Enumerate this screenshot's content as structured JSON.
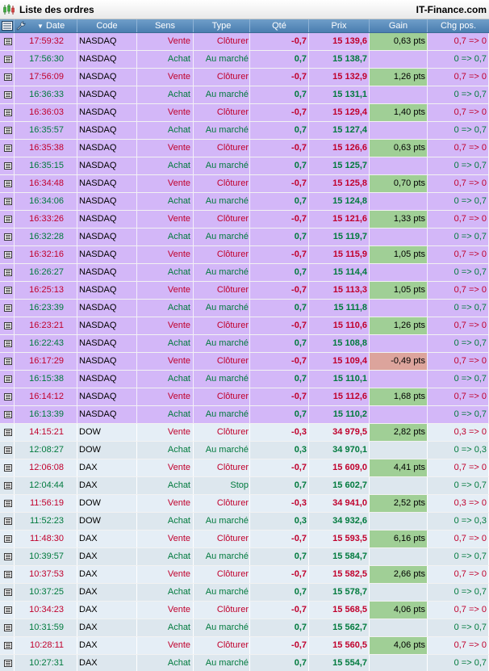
{
  "window": {
    "title": "Liste des ordres",
    "brand": "IT-Finance.com",
    "logo_icon": "candlestick-chart-icon"
  },
  "columns": {
    "icon": "columns-menu-icon",
    "tools": "wrench-icon",
    "sort_indicator": "sort-descending-icon",
    "date": "Date",
    "code": "Code",
    "sens": "Sens",
    "type": "Type",
    "qte": "Qté",
    "prix": "Prix",
    "gain": "Gain",
    "chg": "Chg pos."
  },
  "colors": {
    "nasdaq_row": "#d3b7f8",
    "other_row_even": "#e5eef6",
    "other_row_odd": "#dde7ee",
    "sell": "#c0002c",
    "buy": "#007a3d",
    "gain_positive": "#a0cf96",
    "gain_negative": "#dca49c",
    "header": "#5b8cbd"
  },
  "orders": [
    {
      "date": "17:59:32",
      "code": "NASDAQ",
      "sens": "Vente",
      "type": "Clôturer",
      "qte": "-0,7",
      "prix": "15 139,6",
      "gain": "0,63 pts",
      "chg": "0,7 => 0"
    },
    {
      "date": "17:56:30",
      "code": "NASDAQ",
      "sens": "Achat",
      "type": "Au marché",
      "qte": "0,7",
      "prix": "15 138,7",
      "gain": "",
      "chg": "0 => 0,7"
    },
    {
      "date": "17:56:09",
      "code": "NASDAQ",
      "sens": "Vente",
      "type": "Clôturer",
      "qte": "-0,7",
      "prix": "15 132,9",
      "gain": "1,26 pts",
      "chg": "0,7 => 0"
    },
    {
      "date": "16:36:33",
      "code": "NASDAQ",
      "sens": "Achat",
      "type": "Au marché",
      "qte": "0,7",
      "prix": "15 131,1",
      "gain": "",
      "chg": "0 => 0,7"
    },
    {
      "date": "16:36:03",
      "code": "NASDAQ",
      "sens": "Vente",
      "type": "Clôturer",
      "qte": "-0,7",
      "prix": "15 129,4",
      "gain": "1,40 pts",
      "chg": "0,7 => 0"
    },
    {
      "date": "16:35:57",
      "code": "NASDAQ",
      "sens": "Achat",
      "type": "Au marché",
      "qte": "0,7",
      "prix": "15 127,4",
      "gain": "",
      "chg": "0 => 0,7"
    },
    {
      "date": "16:35:38",
      "code": "NASDAQ",
      "sens": "Vente",
      "type": "Clôturer",
      "qte": "-0,7",
      "prix": "15 126,6",
      "gain": "0,63 pts",
      "chg": "0,7 => 0"
    },
    {
      "date": "16:35:15",
      "code": "NASDAQ",
      "sens": "Achat",
      "type": "Au marché",
      "qte": "0,7",
      "prix": "15 125,7",
      "gain": "",
      "chg": "0 => 0,7"
    },
    {
      "date": "16:34:48",
      "code": "NASDAQ",
      "sens": "Vente",
      "type": "Clôturer",
      "qte": "-0,7",
      "prix": "15 125,8",
      "gain": "0,70 pts",
      "chg": "0,7 => 0"
    },
    {
      "date": "16:34:06",
      "code": "NASDAQ",
      "sens": "Achat",
      "type": "Au marché",
      "qte": "0,7",
      "prix": "15 124,8",
      "gain": "",
      "chg": "0 => 0,7"
    },
    {
      "date": "16:33:26",
      "code": "NASDAQ",
      "sens": "Vente",
      "type": "Clôturer",
      "qte": "-0,7",
      "prix": "15 121,6",
      "gain": "1,33 pts",
      "chg": "0,7 => 0"
    },
    {
      "date": "16:32:28",
      "code": "NASDAQ",
      "sens": "Achat",
      "type": "Au marché",
      "qte": "0,7",
      "prix": "15 119,7",
      "gain": "",
      "chg": "0 => 0,7"
    },
    {
      "date": "16:32:16",
      "code": "NASDAQ",
      "sens": "Vente",
      "type": "Clôturer",
      "qte": "-0,7",
      "prix": "15 115,9",
      "gain": "1,05 pts",
      "chg": "0,7 => 0"
    },
    {
      "date": "16:26:27",
      "code": "NASDAQ",
      "sens": "Achat",
      "type": "Au marché",
      "qte": "0,7",
      "prix": "15 114,4",
      "gain": "",
      "chg": "0 => 0,7"
    },
    {
      "date": "16:25:13",
      "code": "NASDAQ",
      "sens": "Vente",
      "type": "Clôturer",
      "qte": "-0,7",
      "prix": "15 113,3",
      "gain": "1,05 pts",
      "chg": "0,7 => 0"
    },
    {
      "date": "16:23:39",
      "code": "NASDAQ",
      "sens": "Achat",
      "type": "Au marché",
      "qte": "0,7",
      "prix": "15 111,8",
      "gain": "",
      "chg": "0 => 0,7"
    },
    {
      "date": "16:23:21",
      "code": "NASDAQ",
      "sens": "Vente",
      "type": "Clôturer",
      "qte": "-0,7",
      "prix": "15 110,6",
      "gain": "1,26 pts",
      "chg": "0,7 => 0"
    },
    {
      "date": "16:22:43",
      "code": "NASDAQ",
      "sens": "Achat",
      "type": "Au marché",
      "qte": "0,7",
      "prix": "15 108,8",
      "gain": "",
      "chg": "0 => 0,7"
    },
    {
      "date": "16:17:29",
      "code": "NASDAQ",
      "sens": "Vente",
      "type": "Clôturer",
      "qte": "-0,7",
      "prix": "15 109,4",
      "gain": "-0,49 pts",
      "chg": "0,7 => 0"
    },
    {
      "date": "16:15:38",
      "code": "NASDAQ",
      "sens": "Achat",
      "type": "Au marché",
      "qte": "0,7",
      "prix": "15 110,1",
      "gain": "",
      "chg": "0 => 0,7"
    },
    {
      "date": "16:14:12",
      "code": "NASDAQ",
      "sens": "Vente",
      "type": "Clôturer",
      "qte": "-0,7",
      "prix": "15 112,6",
      "gain": "1,68 pts",
      "chg": "0,7 => 0"
    },
    {
      "date": "16:13:39",
      "code": "NASDAQ",
      "sens": "Achat",
      "type": "Au marché",
      "qte": "0,7",
      "prix": "15 110,2",
      "gain": "",
      "chg": "0 => 0,7"
    },
    {
      "date": "14:15:21",
      "code": "DOW",
      "sens": "Vente",
      "type": "Clôturer",
      "qte": "-0,3",
      "prix": "34 979,5",
      "gain": "2,82 pts",
      "chg": "0,3 => 0"
    },
    {
      "date": "12:08:27",
      "code": "DOW",
      "sens": "Achat",
      "type": "Au marché",
      "qte": "0,3",
      "prix": "34 970,1",
      "gain": "",
      "chg": "0 => 0,3"
    },
    {
      "date": "12:06:08",
      "code": "DAX",
      "sens": "Vente",
      "type": "Clôturer",
      "qte": "-0,7",
      "prix": "15 609,0",
      "gain": "4,41 pts",
      "chg": "0,7 => 0"
    },
    {
      "date": "12:04:44",
      "code": "DAX",
      "sens": "Achat",
      "type": "Stop",
      "qte": "0,7",
      "prix": "15 602,7",
      "gain": "",
      "chg": "0 => 0,7"
    },
    {
      "date": "11:56:19",
      "code": "DOW",
      "sens": "Vente",
      "type": "Clôturer",
      "qte": "-0,3",
      "prix": "34 941,0",
      "gain": "2,52 pts",
      "chg": "0,3 => 0"
    },
    {
      "date": "11:52:23",
      "code": "DOW",
      "sens": "Achat",
      "type": "Au marché",
      "qte": "0,3",
      "prix": "34 932,6",
      "gain": "",
      "chg": "0 => 0,3"
    },
    {
      "date": "11:48:30",
      "code": "DAX",
      "sens": "Vente",
      "type": "Clôturer",
      "qte": "-0,7",
      "prix": "15 593,5",
      "gain": "6,16 pts",
      "chg": "0,7 => 0"
    },
    {
      "date": "10:39:57",
      "code": "DAX",
      "sens": "Achat",
      "type": "Au marché",
      "qte": "0,7",
      "prix": "15 584,7",
      "gain": "",
      "chg": "0 => 0,7"
    },
    {
      "date": "10:37:53",
      "code": "DAX",
      "sens": "Vente",
      "type": "Clôturer",
      "qte": "-0,7",
      "prix": "15 582,5",
      "gain": "2,66 pts",
      "chg": "0,7 => 0"
    },
    {
      "date": "10:37:25",
      "code": "DAX",
      "sens": "Achat",
      "type": "Au marché",
      "qte": "0,7",
      "prix": "15 578,7",
      "gain": "",
      "chg": "0 => 0,7"
    },
    {
      "date": "10:34:23",
      "code": "DAX",
      "sens": "Vente",
      "type": "Clôturer",
      "qte": "-0,7",
      "prix": "15 568,5",
      "gain": "4,06 pts",
      "chg": "0,7 => 0"
    },
    {
      "date": "10:31:59",
      "code": "DAX",
      "sens": "Achat",
      "type": "Au marché",
      "qte": "0,7",
      "prix": "15 562,7",
      "gain": "",
      "chg": "0 => 0,7"
    },
    {
      "date": "10:28:11",
      "code": "DAX",
      "sens": "Vente",
      "type": "Clôturer",
      "qte": "-0,7",
      "prix": "15 560,5",
      "gain": "4,06 pts",
      "chg": "0,7 => 0"
    },
    {
      "date": "10:27:31",
      "code": "DAX",
      "sens": "Achat",
      "type": "Au marché",
      "qte": "0,7",
      "prix": "15 554,7",
      "gain": "",
      "chg": "0 => 0,7"
    }
  ]
}
